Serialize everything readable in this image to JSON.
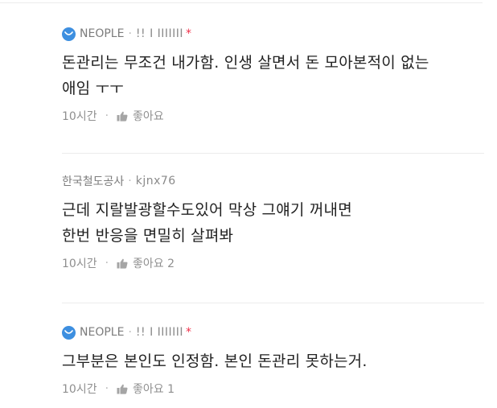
{
  "comments": [
    {
      "company": "NEOPLE",
      "has_company_icon": true,
      "author": "!! I IIIIIII",
      "verified_mark": "*",
      "text_lines": [
        "돈관리는 무조건 내가함. 인생 살면서 돈 모아본적이 없는",
        "애임 ㅜㅜ"
      ],
      "time": "10시간",
      "like_label": "좋아요",
      "like_count": ""
    },
    {
      "company": "한국철도공사",
      "has_company_icon": false,
      "author": "kjnx76",
      "verified_mark": "",
      "text_lines": [
        "근데 지랄발광할수도있어 막상 그얘기 꺼내면",
        "한번 반응을 면밀히 살펴봐"
      ],
      "time": "10시간",
      "like_label": "좋아요",
      "like_count": "2"
    },
    {
      "company": "NEOPLE",
      "has_company_icon": true,
      "author": "!! I IIIIIII",
      "verified_mark": "*",
      "text_lines": [
        "그부분은 본인도 인정함. 본인 돈관리 못하는거."
      ],
      "time": "10시간",
      "like_label": "좋아요",
      "like_count": "1"
    }
  ],
  "separator": "·",
  "colors": {
    "company_icon": "#3d8fe0",
    "verified_mark": "#f0314a",
    "body_text": "#222222",
    "meta_text": "#8f8f8f",
    "divider": "#ececec"
  },
  "icons": {
    "company_icon": "company-logo-icon",
    "like_icon": "thumbs-up-icon"
  }
}
